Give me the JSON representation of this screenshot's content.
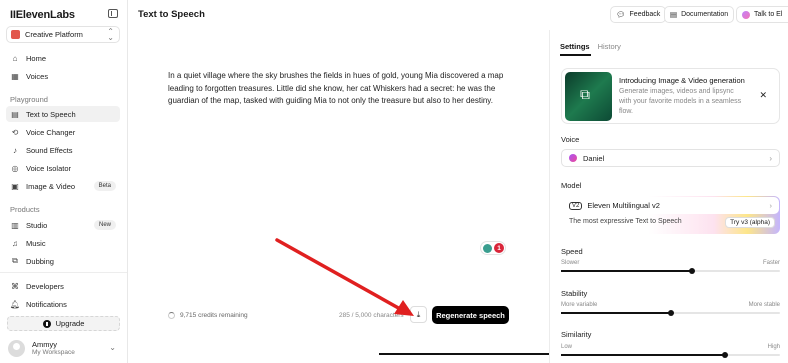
{
  "sidebar": {
    "brand": "IIElevenLabs",
    "workspace": "Creative Platform",
    "top_items": [
      {
        "label": "Home",
        "icon": "home-icon"
      },
      {
        "label": "Voices",
        "icon": "voices-icon"
      }
    ],
    "playground_label": "Playground",
    "playground_items": [
      {
        "label": "Text to Speech",
        "icon": "text-icon",
        "active": true
      },
      {
        "label": "Voice Changer",
        "icon": "voice-changer-icon"
      },
      {
        "label": "Sound Effects",
        "icon": "sound-icon"
      },
      {
        "label": "Voice Isolator",
        "icon": "isolator-icon"
      },
      {
        "label": "Image & Video",
        "icon": "image-icon",
        "badge": "Beta"
      }
    ],
    "products_label": "Products",
    "product_items": [
      {
        "label": "Studio",
        "icon": "studio-icon",
        "badge": "New"
      },
      {
        "label": "Music",
        "icon": "music-icon"
      },
      {
        "label": "Dubbing",
        "icon": "dubbing-icon"
      }
    ],
    "bottom_items": [
      {
        "label": "Developers",
        "icon": "developers-icon"
      },
      {
        "label": "Notifications",
        "icon": "bell-icon"
      }
    ],
    "upgrade_label": "Upgrade",
    "user_name": "Ammyy",
    "user_workspace": "My Workspace"
  },
  "topbar": {
    "title": "Text to Speech",
    "feedback": "Feedback",
    "documentation": "Documentation",
    "talk": "Talk to El"
  },
  "editor": {
    "text": "In a quiet village where the sky brushes the fields in hues of gold, young Mia discovered a map leading to forgotten treasures. Little did she know, her cat Whiskers had a secret: he was the guardian of the map, tasked with guiding Mia to not only the treasure but also to her destiny.",
    "notification_count": "1",
    "credits": "9,715 credits remaining",
    "char_count": "285 / 5,000 characters",
    "regenerate": "Regenerate speech"
  },
  "panel": {
    "tabs": [
      "Settings",
      "History"
    ],
    "promo_title": "Introducing Image & Video generation",
    "promo_desc": "Generate images, videos and lipsync with your favorite models in a seamless flow.",
    "voice_label": "Voice",
    "voice_value": "Daniel",
    "model_label": "Model",
    "model_tag": "V2",
    "model_value": "Eleven Multilingual v2",
    "model_desc": "The most expressive Text to Speech",
    "try_label": "Try v3 (alpha)",
    "speed": {
      "label": "Speed",
      "min": "Slower",
      "max": "Faster",
      "value": 0.6
    },
    "stability": {
      "label": "Stability",
      "min": "More variable",
      "max": "More stable",
      "value": 0.5
    },
    "similarity": {
      "label": "Similarity",
      "min": "Low",
      "max": "High",
      "value": 0.75
    }
  }
}
